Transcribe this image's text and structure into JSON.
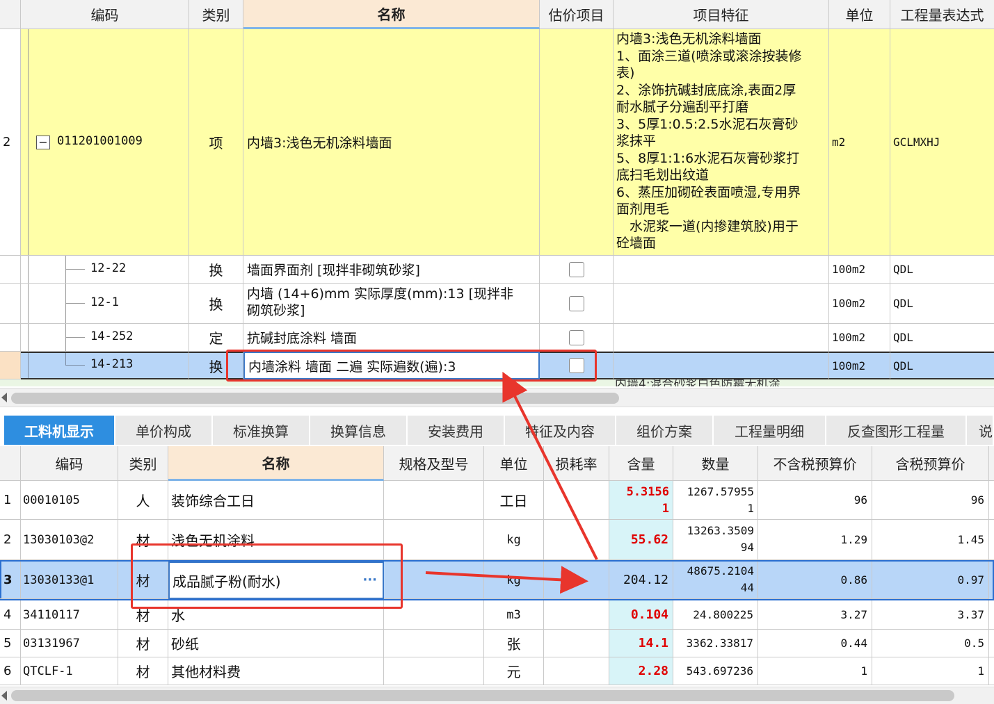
{
  "top": {
    "headers": [
      "编码",
      "类别",
      "名称",
      "估价项目",
      "项目特征",
      "单位",
      "工程量表达式"
    ],
    "rows": [
      {
        "num": "2",
        "code": "011201001009",
        "type": "项",
        "name": "内墙3:浅色无机涂料墙面",
        "unit": "m2",
        "expr": "GCLMXHJ",
        "features": [
          "内墙3:浅色无机涂料墙面",
          "1、面涂三道(喷涂或滚涂按装修",
          "表)",
          "2、涂饰抗碱封底底涂,表面2厚",
          "耐水腻子分遍刮平打磨",
          "3、5厚1:0.5:2.5水泥石灰膏砂",
          "浆抹平",
          "5、8厚1:1:6水泥石灰膏砂浆打",
          "底扫毛划出纹道",
          "6、蒸压加砌砼表面喷湿,专用界",
          "面剂甩毛",
          "　水泥浆一道(内掺建筑胶)用于",
          "砼墙面"
        ]
      },
      {
        "code": "12-22",
        "type": "换",
        "name": "墙面界面剂  [现拌非砌筑砂浆]",
        "unit": "100m2",
        "expr": "QDL"
      },
      {
        "code": "12-1",
        "type": "换",
        "name_line1": "内墙 (14+6)mm  实际厚度(mm):13  [现拌非",
        "name_line2": "砌筑砂浆]",
        "unit": "100m2",
        "expr": "QDL"
      },
      {
        "code": "14-252",
        "type": "定",
        "name": "抗碱封底涂料 墙面",
        "unit": "100m2",
        "expr": "QDL"
      },
      {
        "code": "14-213",
        "type": "换",
        "name": "内墙涂料 墙面 二遍  实际遍数(遍):3",
        "unit": "100m2",
        "expr": "QDL"
      }
    ],
    "partial_text": "内墙4:混合砂浆白色防霉无机涂"
  },
  "tabs": [
    "工料机显示",
    "单价构成",
    "标准换算",
    "换算信息",
    "安装费用",
    "特征及内容",
    "组价方案",
    "工程量明细",
    "反查图形工程量",
    "说"
  ],
  "bottom": {
    "headers": [
      "编码",
      "类别",
      "名称",
      "规格及型号",
      "单位",
      "损耗率",
      "含量",
      "数量",
      "不含税预算价",
      "含税预算价"
    ],
    "rows": [
      {
        "num": "1",
        "code": "00010105",
        "type": "人",
        "name": "装饰综合工日",
        "unit": "工日",
        "qty1": "5.3156",
        "qty2": "1",
        "amt1": "1267.57955",
        "amt2": "1",
        "p1": "96",
        "p2": "96"
      },
      {
        "num": "2",
        "code": "13030103@2",
        "type": "材",
        "name": "浅色无机涂料",
        "unit": "kg",
        "qty1": "55.62",
        "amt1": "13263.3509",
        "amt2": "94",
        "p1": "1.29",
        "p2": "1.45"
      },
      {
        "num": "3",
        "code": "13030133@1",
        "type": "材",
        "name": "成品腻子粉(耐水)",
        "unit": "kg",
        "qty1": "204.12",
        "amt1": "48675.2104",
        "amt2": "44",
        "p1": "0.86",
        "p2": "0.97",
        "more": "···"
      },
      {
        "num": "4",
        "code": "34110117",
        "type": "材",
        "name": "水",
        "unit": "m3",
        "qty1": "0.104",
        "amt1": "24.800225",
        "p1": "3.27",
        "p2": "3.37"
      },
      {
        "num": "5",
        "code": "03131967",
        "type": "材",
        "name": "砂纸",
        "unit": "张",
        "qty1": "14.1",
        "amt1": "3362.33817",
        "p1": "0.44",
        "p2": "0.5"
      },
      {
        "num": "6",
        "code": "QTCLF-1",
        "type": "材",
        "name": "其他材料费",
        "unit": "元",
        "qty1": "2.28",
        "amt1": "543.697236",
        "p1": "1",
        "p2": "1"
      }
    ]
  },
  "colors": {
    "accent": "#2e8ee0",
    "highlight_yellow": "#ffffa8",
    "selected": "#b8d6f8",
    "annotation_red": "#e8352c"
  }
}
